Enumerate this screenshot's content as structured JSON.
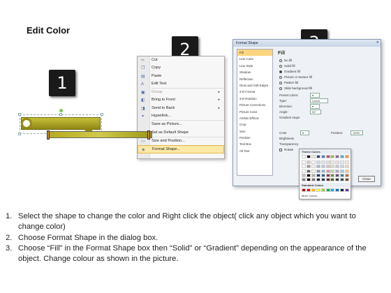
{
  "title": "Edit Color",
  "badges": [
    "1",
    "2",
    "3"
  ],
  "context_menu": {
    "items": [
      {
        "label": "Cut",
        "icon": "scissors-icon",
        "glyph": "✂",
        "state": "normal",
        "submenu": false
      },
      {
        "label": "Copy",
        "icon": "copy-icon",
        "glyph": "❐",
        "state": "normal",
        "submenu": false
      },
      {
        "label": "Paste",
        "icon": "paste-icon",
        "glyph": "▤",
        "state": "normal",
        "submenu": false
      },
      {
        "label": "Edit Text",
        "icon": "edit-text-icon",
        "glyph": "A",
        "state": "normal",
        "submenu": false
      },
      {
        "label": "Group",
        "icon": "group-icon",
        "glyph": "▣",
        "state": "disabled",
        "submenu": true
      },
      {
        "label": "Bring to Front",
        "icon": "bring-front-icon",
        "glyph": "◧",
        "state": "normal",
        "submenu": true
      },
      {
        "label": "Send to Back",
        "icon": "send-back-icon",
        "glyph": "◨",
        "state": "normal",
        "submenu": true
      },
      {
        "label": "Hyperlink...",
        "icon": "hyperlink-icon",
        "glyph": "⚭",
        "state": "normal",
        "submenu": false
      },
      {
        "label": "Save as Picture...",
        "icon": "",
        "glyph": "",
        "state": "normal",
        "submenu": false
      },
      {
        "label": "Set as Default Shape",
        "icon": "",
        "glyph": "",
        "state": "normal",
        "submenu": false
      },
      {
        "label": "Size and Position...",
        "icon": "size-icon",
        "glyph": "▭",
        "state": "normal",
        "submenu": false
      },
      {
        "label": "Format Shape...",
        "icon": "format-shape-icon",
        "glyph": "◈",
        "state": "highlighted",
        "submenu": false
      }
    ]
  },
  "dialog": {
    "title": "Format Shape",
    "nav_items": [
      "Fill",
      "Line Color",
      "Line Style",
      "Shadow",
      "Reflection",
      "Glow and Soft Edges",
      "3-D Format",
      "3-D Rotation",
      "Picture Corrections",
      "Picture Color",
      "Artistic Effects",
      "Crop",
      "Size",
      "Position",
      "Text Box",
      "Alt Text"
    ],
    "active_nav": "Fill",
    "pane_heading": "Fill",
    "fill_options": [
      {
        "label": "No fill",
        "selected": false
      },
      {
        "label": "Solid fill",
        "selected": false
      },
      {
        "label": "Gradient fill",
        "selected": true
      },
      {
        "label": "Picture or texture fill",
        "selected": false
      },
      {
        "label": "Pattern fill",
        "selected": false
      },
      {
        "label": "Slide background fill",
        "selected": false
      }
    ],
    "preset_colors_label": "Preset colors:",
    "type_label": "Type:",
    "type_value": "Linear",
    "direction_label": "Direction:",
    "angle_label": "Angle:",
    "angle_value": "90°",
    "gradient_stops_label": "Gradient stops",
    "color_label": "Color",
    "position_label": "Position:",
    "position_value": "100%",
    "brightness_label": "Brightness",
    "transparency_label": "Transparency",
    "rotate_label": "Rotate",
    "close_label": "Close"
  },
  "palette": {
    "theme_label": "Theme Colors",
    "standard_label": "Standard Colors",
    "more_label": "More Colors...",
    "theme_colors": [
      "#ffffff",
      "#000000",
      "#eeece1",
      "#1f497d",
      "#4f81bd",
      "#c0504d",
      "#9bbb59",
      "#8064a2",
      "#4bacc6",
      "#f79646"
    ],
    "standard_colors": [
      "#c00000",
      "#ff0000",
      "#ffc000",
      "#ffff00",
      "#92d050",
      "#00b050",
      "#00b0f0",
      "#0070c0",
      "#002060",
      "#7030a0"
    ]
  },
  "shape_color": "#a39b1b",
  "instructions": [
    {
      "num": "1.",
      "text": "Select the shape to change the color and Right click the object( click any object which you want to change color)"
    },
    {
      "num": "2.",
      "text": "Choose Format Shape in the dialog box."
    },
    {
      "num": "3.",
      "text": "Choose “Fill” in the Format Shape box then “Solid” or “Gradient” depending on the appearance of the object. Change colour as shown in the picture."
    }
  ]
}
